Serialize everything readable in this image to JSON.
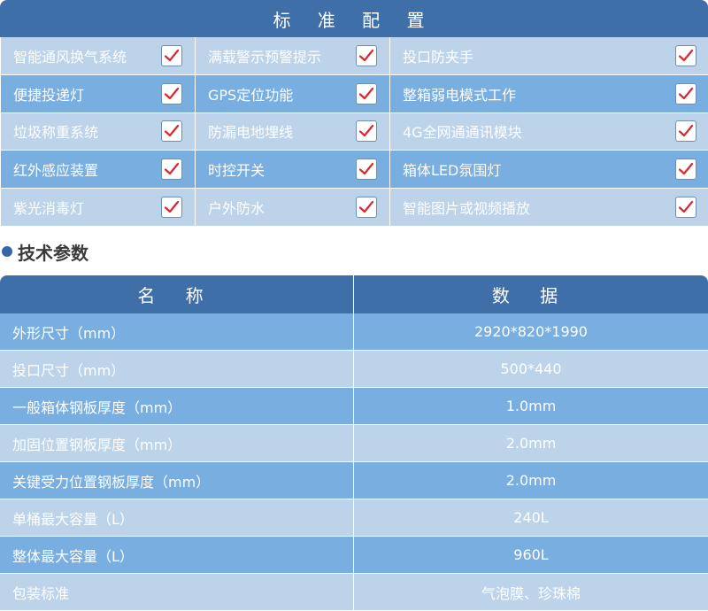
{
  "standard_config": {
    "title": "标 准 配 置",
    "rows": [
      [
        "智能通风换气系统",
        "满载警示预警提示",
        "投口防夹手"
      ],
      [
        "便捷投递灯",
        "GPS定位功能",
        "整箱弱电模式工作"
      ],
      [
        "垃圾称重系统",
        "防漏电地埋线",
        "4G全网通通讯模块"
      ],
      [
        "红外感应装置",
        "时控开关",
        "箱体LED氛围灯"
      ],
      [
        "紫光消毒灯",
        "户外防水",
        "智能图片或视频播放"
      ]
    ],
    "check_icon": "checkmark-icon",
    "check_color": "#d9282f"
  },
  "tech_params": {
    "section_title": "技术参数",
    "header": {
      "name": "名 称",
      "value": "数 据"
    },
    "rows": [
      {
        "name": "外形尺寸（mm）",
        "value": "2920*820*1990"
      },
      {
        "name": "投口尺寸（mm）",
        "value": "500*440"
      },
      {
        "name": "一般箱体钢板厚度（mm）",
        "value": "1.0mm"
      },
      {
        "name": "加固位置钢板厚度（mm）",
        "value": "2.0mm"
      },
      {
        "name": "关键受力位置钢板厚度（mm）",
        "value": "2.0mm"
      },
      {
        "name": "单桶最大容量（L）",
        "value": "240L"
      },
      {
        "name": "整体最大容量（L）",
        "value": "960L"
      },
      {
        "name": "包装标准",
        "value": "气泡膜、珍珠棉"
      }
    ]
  },
  "colors": {
    "header": "#3f6fa8",
    "row_light": "#bcd3ea",
    "row_dark": "#78aee0",
    "accent_dot": "#3567a8"
  }
}
